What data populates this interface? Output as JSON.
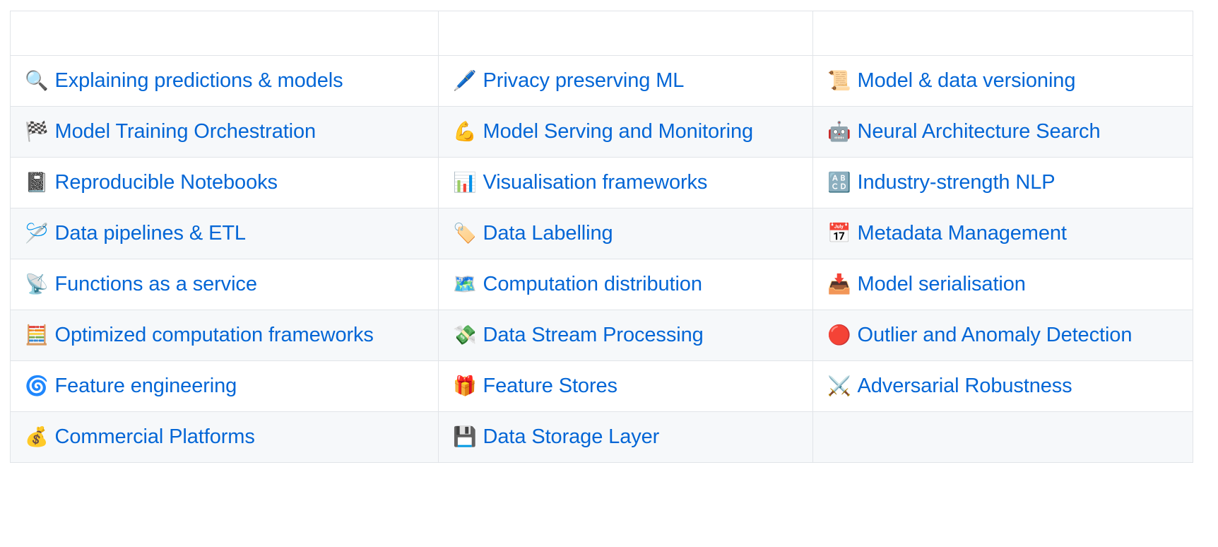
{
  "table": {
    "header": {
      "col1": "",
      "col2": "",
      "col3": ""
    },
    "columns": [
      "",
      "",
      ""
    ],
    "rows": [
      {
        "cells": [
          {
            "icon": "magnifying-glass-icon",
            "glyph": "🔍",
            "label": "Explaining predictions & models"
          },
          {
            "icon": "locked-with-pen-icon",
            "glyph": "🖊️",
            "label": "Privacy preserving ML"
          },
          {
            "icon": "scroll-icon",
            "glyph": "📜",
            "label": "Model & data versioning"
          }
        ]
      },
      {
        "cells": [
          {
            "icon": "chequered-flag-icon",
            "glyph": "🏁",
            "label": "Model Training Orchestration"
          },
          {
            "icon": "flexed-biceps-icon",
            "glyph": "💪",
            "label": "Model Serving and Monitoring"
          },
          {
            "icon": "robot-icon",
            "glyph": "🤖",
            "label": "Neural Architecture Search"
          }
        ]
      },
      {
        "cells": [
          {
            "icon": "notebook-icon",
            "glyph": "📓",
            "label": "Reproducible Notebooks"
          },
          {
            "icon": "bar-chart-icon",
            "glyph": "📊",
            "label": "Visualisation frameworks"
          },
          {
            "icon": "input-latin-uppercase-icon",
            "glyph": "🔠",
            "label": "Industry-strength NLP"
          }
        ]
      },
      {
        "cells": [
          {
            "icon": "thread-spool-icon",
            "glyph": "🪡",
            "label": "Data pipelines & ETL"
          },
          {
            "icon": "label-tag-icon",
            "glyph": "🏷️",
            "label": "Data Labelling"
          },
          {
            "icon": "calendar-icon",
            "glyph": "📅",
            "label": "Metadata Management"
          }
        ]
      },
      {
        "cells": [
          {
            "icon": "satellite-antenna-icon",
            "glyph": "📡",
            "label": "Functions as a service"
          },
          {
            "icon": "world-map-icon",
            "glyph": "🗺️",
            "label": "Computation distribution"
          },
          {
            "icon": "inbox-tray-icon",
            "glyph": "📥",
            "label": "Model serialisation"
          }
        ]
      },
      {
        "cells": [
          {
            "icon": "abacus-icon",
            "glyph": "🧮",
            "label": "Optimized computation frameworks"
          },
          {
            "icon": "money-with-wings-icon",
            "glyph": "💸",
            "label": "Data Stream Processing"
          },
          {
            "icon": "red-circle-icon",
            "glyph": "🔴",
            "label": "Outlier and Anomaly Detection"
          }
        ]
      },
      {
        "cells": [
          {
            "icon": "cyclone-icon",
            "glyph": "🌀",
            "label": "Feature engineering"
          },
          {
            "icon": "wrapped-gift-icon",
            "glyph": "🎁",
            "label": "Feature Stores"
          },
          {
            "icon": "crossed-swords-icon",
            "glyph": "⚔️",
            "label": "Adversarial Robustness"
          }
        ]
      },
      {
        "cells": [
          {
            "icon": "money-bag-icon",
            "glyph": "💰",
            "label": "Commercial Platforms"
          },
          {
            "icon": "floppy-disk-icon",
            "glyph": "💾",
            "label": "Data Storage Layer"
          },
          {
            "icon": "",
            "glyph": "",
            "label": ""
          }
        ]
      }
    ]
  },
  "colors": {
    "link": "#0366d6",
    "border": "#e1e4e8",
    "row_alt_bg": "#f6f8fa",
    "row_bg": "#ffffff",
    "page_bg": "#ffffff"
  }
}
